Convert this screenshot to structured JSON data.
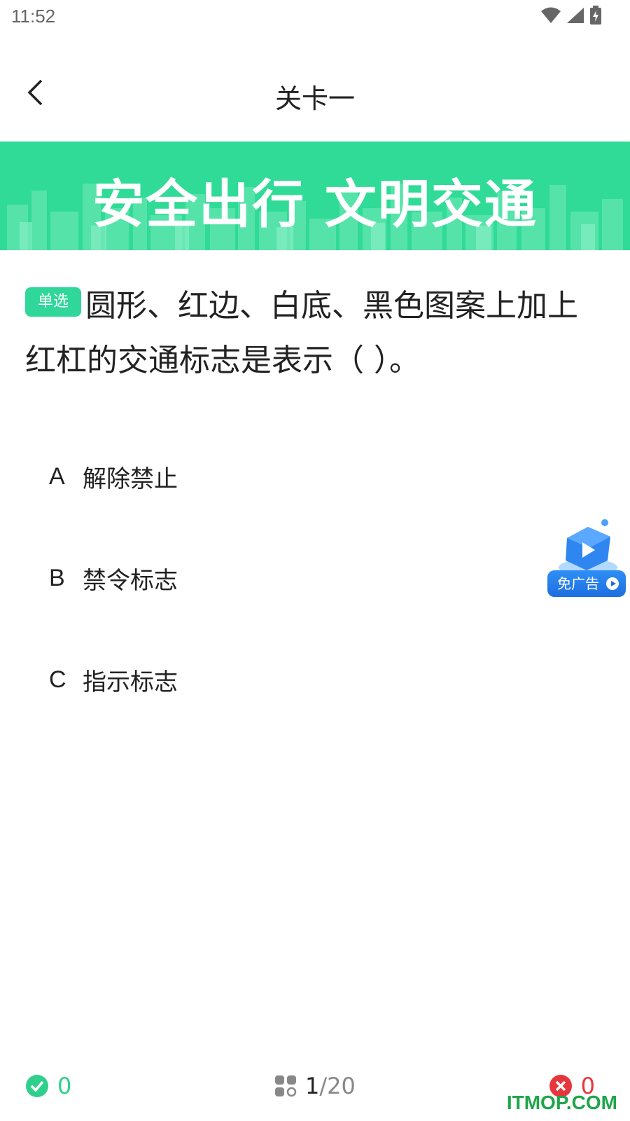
{
  "status_bar": {
    "time": "11:52"
  },
  "nav": {
    "title": "关卡一"
  },
  "banner": {
    "title": "安全出行 文明交通"
  },
  "question": {
    "type_badge": "单选",
    "text": "圆形、红边、白底、黑色图案上加上红杠的交通标志是表示（ ）。"
  },
  "options": [
    {
      "letter": "A",
      "text": "解除禁止"
    },
    {
      "letter": "B",
      "text": "禁令标志"
    },
    {
      "letter": "C",
      "text": "指示标志"
    }
  ],
  "ad_button": {
    "label": "免广告"
  },
  "footer": {
    "correct_count": "0",
    "current": "1",
    "total": "/20",
    "wrong_count": "0"
  },
  "watermark": "ITMOP.COM",
  "colors": {
    "accent": "#2fdb96",
    "correct": "#2fd08d",
    "wrong": "#e8353d",
    "ad_blue": "#1e6ee0"
  }
}
